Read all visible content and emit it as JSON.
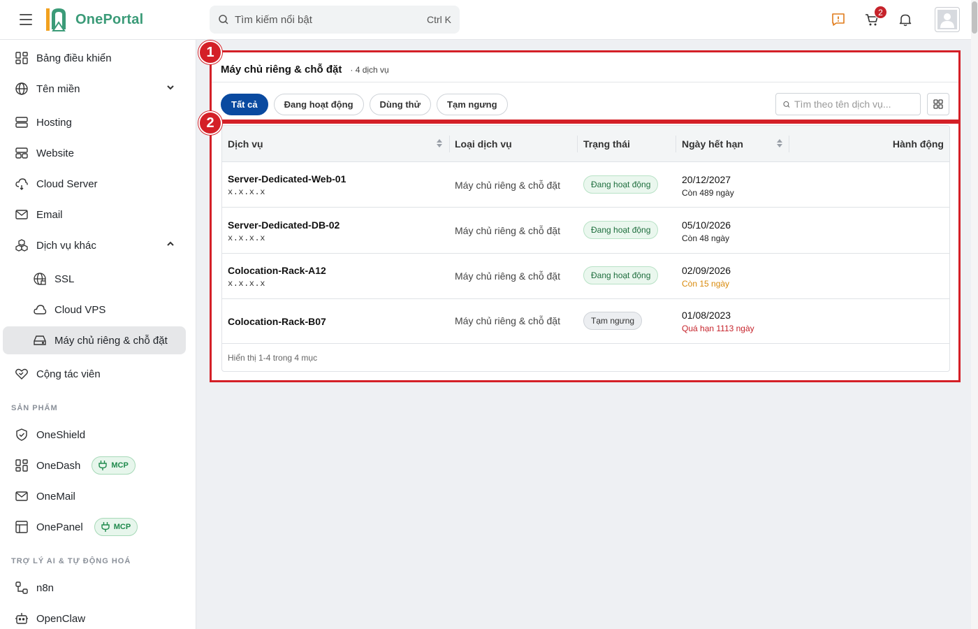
{
  "header": {
    "app_name": "OnePortal",
    "search_placeholder": "Tìm kiếm nổi bật",
    "search_shortcut": "Ctrl K",
    "cart_count": "2",
    "icons": [
      "menu-icon",
      "feedback-icon",
      "cart-icon",
      "bell-icon",
      "user-avatar-icon"
    ]
  },
  "sidebar": {
    "items": [
      {
        "label": "Bảng điều khiển",
        "icon": "dashboard-icon"
      },
      {
        "label": "Tên miền",
        "icon": "globe-icon"
      },
      {
        "label": "Hosting",
        "icon": "server-icon"
      },
      {
        "label": "Website",
        "icon": "website-icon"
      },
      {
        "label": "Cloud Server",
        "icon": "cloud-server-icon"
      },
      {
        "label": "Email",
        "icon": "mail-icon"
      },
      {
        "label": "Dịch vụ khác",
        "icon": "boxes-icon"
      },
      {
        "label": "SSL",
        "icon": "ssl-globe-icon"
      },
      {
        "label": "Cloud VPS",
        "icon": "cloud-icon"
      },
      {
        "label": "Máy chủ riêng & chỗ đặt",
        "icon": "hard-drive-icon"
      },
      {
        "label": "Cộng tác viên",
        "icon": "handshake-heart-icon"
      }
    ],
    "section_products": "SẢN PHẨM",
    "products": [
      {
        "label": "OneShield",
        "icon": "shield-icon"
      },
      {
        "label": "OneDash",
        "icon": "dashboard-icon",
        "badge": "MCP"
      },
      {
        "label": "OneMail",
        "icon": "mail-icon"
      },
      {
        "label": "OnePanel",
        "icon": "panel-icon",
        "badge": "MCP"
      }
    ],
    "section_ai": "TRỢ LÝ AI & TỰ ĐỘNG HOÁ",
    "ai": [
      {
        "label": "n8n",
        "icon": "workflow-icon"
      },
      {
        "label": "OpenClaw",
        "icon": "robot-icon"
      }
    ]
  },
  "markers": [
    "1",
    "2"
  ],
  "main": {
    "title": "Máy chủ riêng & chỗ đặt",
    "count": "· 4 dịch vụ",
    "tabs": [
      {
        "label": "Tất cả",
        "active": true
      },
      {
        "label": "Đang hoạt động"
      },
      {
        "label": "Dùng thử"
      },
      {
        "label": "Tạm ngưng"
      }
    ],
    "search_placeholder": "Tìm theo tên dịch vụ...",
    "table": {
      "columns": [
        "Dịch vụ",
        "Loại dịch vụ",
        "Trạng thái",
        "Ngày hết hạn",
        "Hành động"
      ],
      "rows": [
        {
          "name": "Server-Dedicated-Web-01",
          "ip": "x.x.x.x",
          "type": "Máy chủ riêng & chỗ đặt",
          "status": "Đang hoạt động",
          "expiry": "20/12/2027",
          "remaining": "Còn 489 ngày"
        },
        {
          "name": "Server-Dedicated-DB-02",
          "ip": "x.x.x.x",
          "type": "Máy chủ riêng & chỗ đặt",
          "status": "Đang hoạt động",
          "expiry": "05/10/2026",
          "remaining": "Còn 48 ngày"
        },
        {
          "name": "Colocation-Rack-A12",
          "ip": "x.x.x.x",
          "type": "Máy chủ riêng & chỗ đặt",
          "status": "Đang hoạt động",
          "expiry": "02/09/2026",
          "remaining": "Còn 15 ngày"
        },
        {
          "name": "Colocation-Rack-B07",
          "ip": "",
          "type": "Máy chủ riêng & chỗ đặt",
          "status": "Tạm ngưng",
          "expiry": "01/08/2023",
          "remaining": "Quá hạn 1113 ngày"
        }
      ],
      "footer": "Hiển thị 1-4 trong 4 mục"
    }
  },
  "colors": {
    "primary": "#0a4aa0",
    "brand": "#3b9b78",
    "highlight": "#d42027",
    "warn": "#d98a0b",
    "danger": "#c6232b"
  }
}
